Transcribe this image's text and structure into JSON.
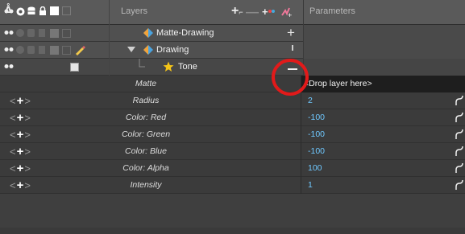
{
  "layers_panel": {
    "title": "Layers",
    "rows": [
      {
        "name": "Matte-Drawing"
      },
      {
        "name": "Drawing"
      },
      {
        "name": "Tone"
      }
    ]
  },
  "parameters_panel": {
    "title": "Parameters",
    "matte": {
      "label": "Matte",
      "value": "<Drop layer here>"
    },
    "params": [
      {
        "label": "Radius",
        "value": "2"
      },
      {
        "label": "Color: Red",
        "value": "-100"
      },
      {
        "label": "Color: Green",
        "value": "-100"
      },
      {
        "label": "Color: Blue",
        "value": "-100"
      },
      {
        "label": "Color: Alpha",
        "value": "100"
      },
      {
        "label": "Intensity",
        "value": "1"
      }
    ]
  },
  "colors": {
    "value_blue": "#6fc8ff",
    "highlight_red": "#e21a1a",
    "tone_star": "#f5c518"
  },
  "icons": [
    "glasses-icon",
    "eye-icon",
    "database-icon",
    "lock-icon",
    "swatch-icon",
    "add-layer-icon",
    "effect-icon",
    "pegs-icon",
    "star-icon",
    "drawing-layer-icon",
    "triangle-down-icon",
    "pencil-icon",
    "curve-icon"
  ]
}
